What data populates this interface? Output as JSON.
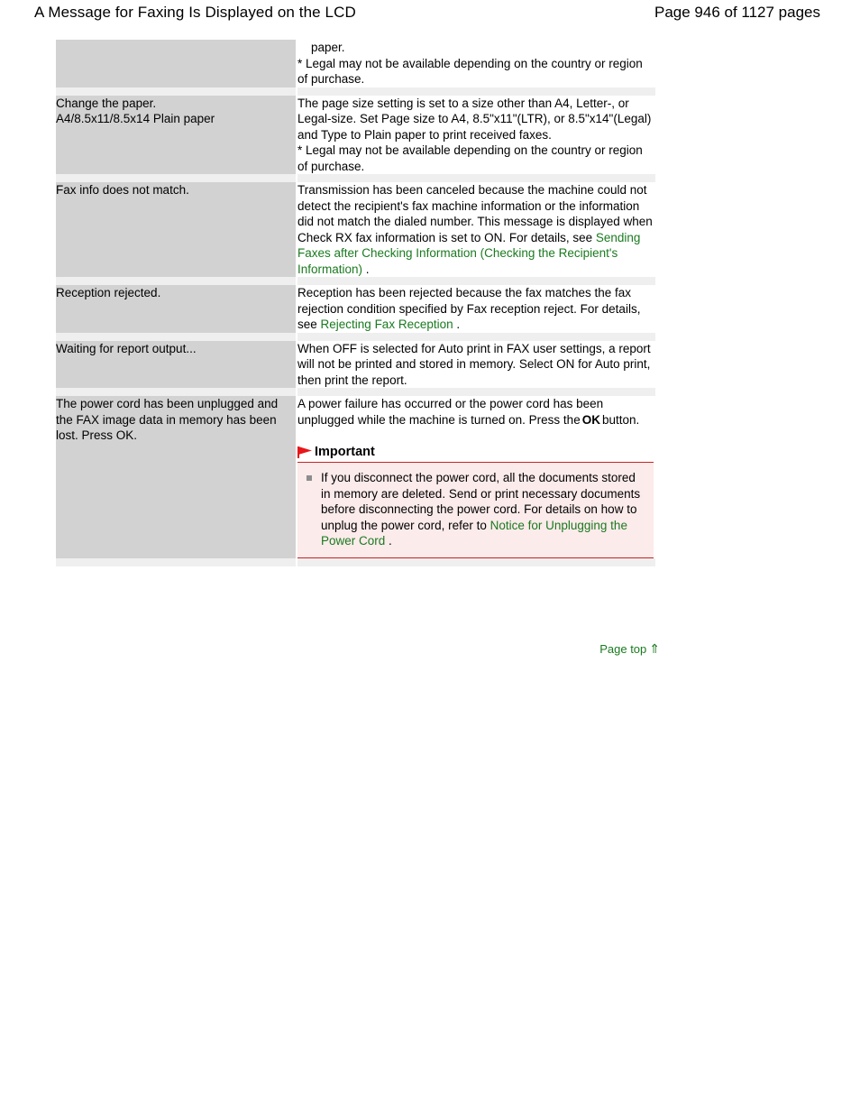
{
  "header": {
    "doc_title": "A Message for Faxing Is Displayed on the LCD",
    "page_count": "Page 946 of 1127 pages"
  },
  "table": {
    "rows": [
      {
        "message": "",
        "action_parts": [
          {
            "type": "text",
            "value": "    paper.\n* Legal may not be available depending on the country or region of purchase."
          }
        ]
      },
      {
        "message": "Change the paper.\nA4/8.5x11/8.5x14 Plain paper",
        "action_parts": [
          {
            "type": "text",
            "value": "The page size setting is set to a size other than A4, Letter-, or Legal-size. Set Page size to A4, 8.5\"x11\"(LTR), or 8.5\"x14\"(Legal) and Type to Plain paper to print received faxes.\n* Legal may not be available depending on the country or region of purchase."
          }
        ]
      },
      {
        "message": "Fax info does not match.",
        "action_parts": [
          {
            "type": "text",
            "value": "Transmission has been canceled because the machine could not detect the recipient's fax machine information or the information did not match the dialed number. This message is displayed when Check RX fax information is set to ON. For details, see "
          },
          {
            "type": "link",
            "value": "Sending Faxes after Checking Information (Checking the Recipient's Information)"
          },
          {
            "type": "text",
            "value": " ."
          }
        ]
      },
      {
        "message": "Reception rejected.",
        "action_parts": [
          {
            "type": "text",
            "value": "Reception has been rejected because the fax matches the fax rejection condition specified by Fax reception reject. For details, see "
          },
          {
            "type": "link",
            "value": "Rejecting Fax Reception"
          },
          {
            "type": "text",
            "value": " ."
          }
        ]
      },
      {
        "message": "Waiting for report output...",
        "action_parts": [
          {
            "type": "text",
            "value": "When OFF is selected for Auto print in FAX user settings, a report will not be printed and stored in memory. Select ON for Auto print, then print the report."
          }
        ]
      },
      {
        "message": "The power cord has been unplugged and the FAX image data in memory has been lost. Press OK.",
        "action_parts": [
          {
            "type": "text",
            "value": "A power failure has occurred or the power cord has been unplugged while the machine is turned on. Press the"
          },
          {
            "type": "bold",
            "value": "OK"
          },
          {
            "type": "text",
            "value": "button."
          }
        ],
        "important": {
          "icon": "red-flag-icon",
          "title": "Important",
          "items": [
            {
              "parts": [
                {
                  "type": "text",
                  "value": "If you disconnect the power cord, all the documents stored in memory are deleted. Send or print necessary documents before disconnecting the power cord. For details on how to unplug the power cord, refer to "
                },
                {
                  "type": "link",
                  "value": "Notice for Unplugging the Power Cord"
                },
                {
                  "type": "text",
                  "value": " ."
                }
              ]
            }
          ]
        }
      }
    ]
  },
  "footer": {
    "page_top_label": "Page top",
    "up_arrow_icon": "⇑"
  },
  "colors": {
    "link_green": "#1a7a1f",
    "message_cell_bg": "#d2d2d2",
    "row_separator": "#efefef",
    "important_bg": "#fcebeb",
    "important_border": "#cc2222",
    "flag_red": "#e8161a"
  }
}
